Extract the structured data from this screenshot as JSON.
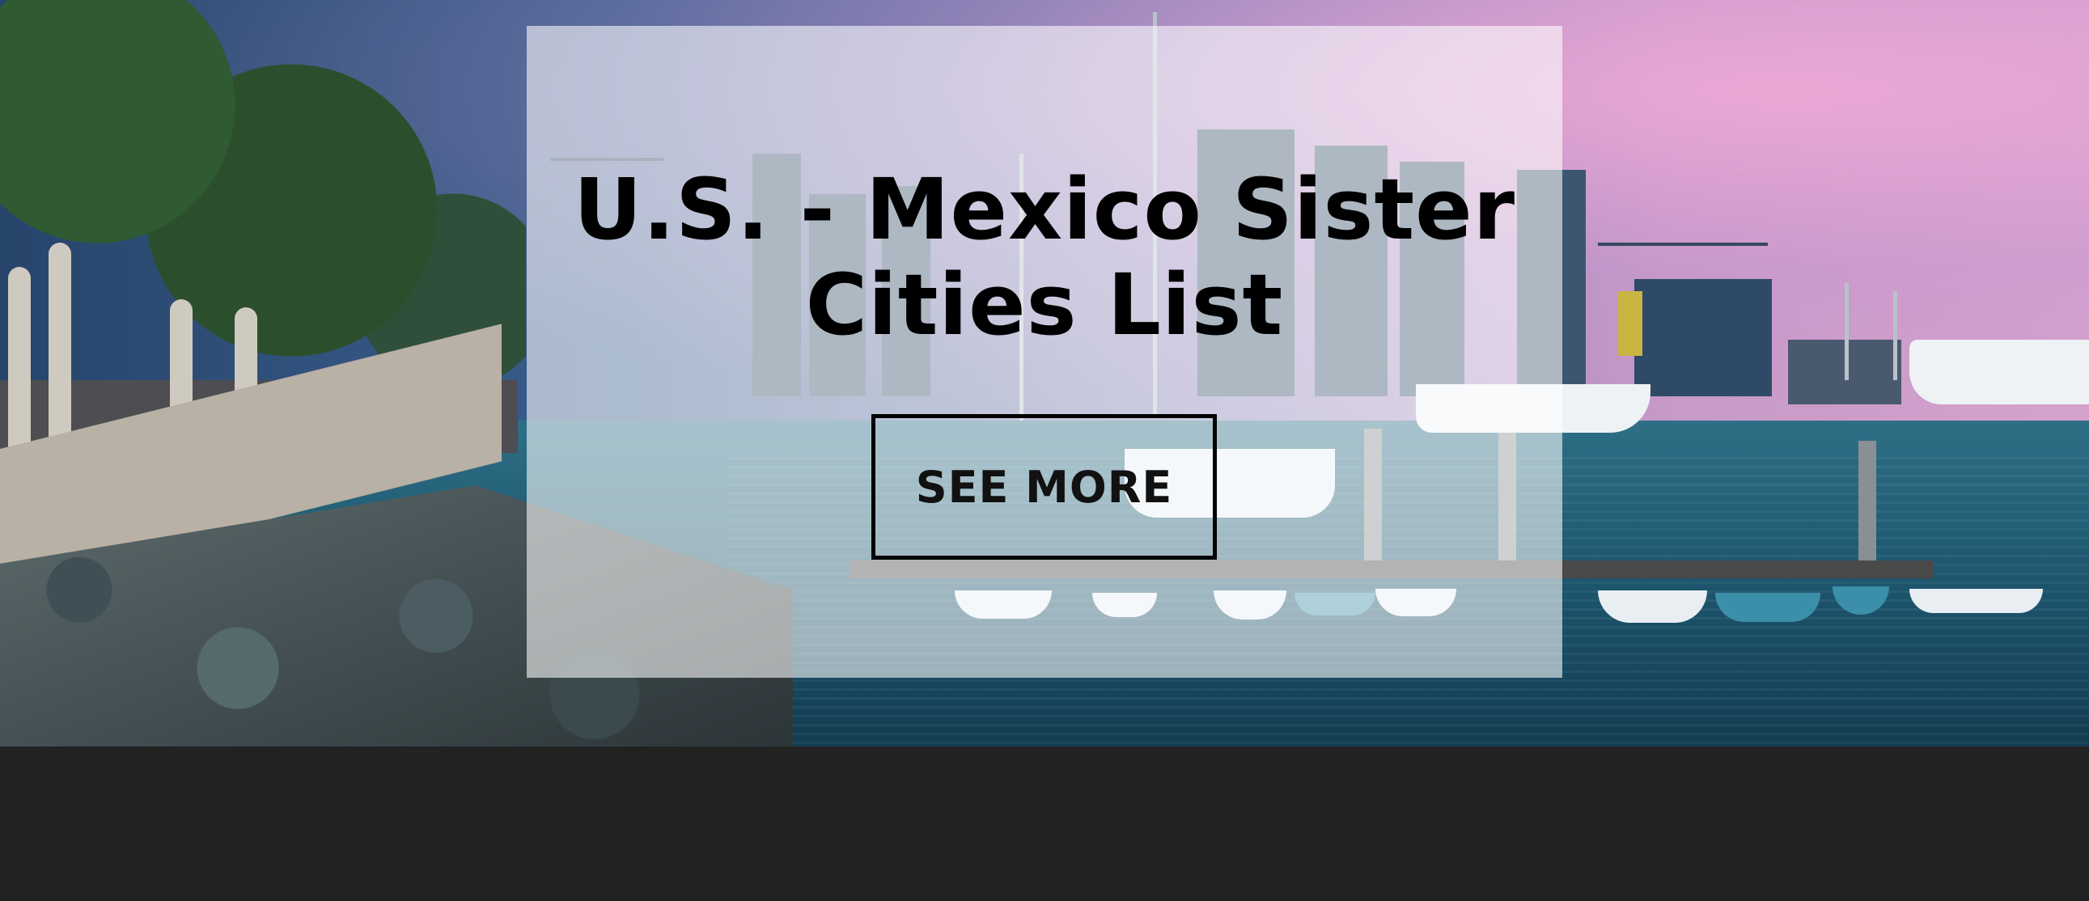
{
  "hero": {
    "title": "U.S. - Mexico Sister Cities List",
    "button_label": "SEE MORE",
    "background_image": "san-diego-harbor-skyline-photo"
  },
  "colors": {
    "overlay": "#ffffff",
    "title": "#000000",
    "button_border": "#000000",
    "footer": "#222222"
  }
}
